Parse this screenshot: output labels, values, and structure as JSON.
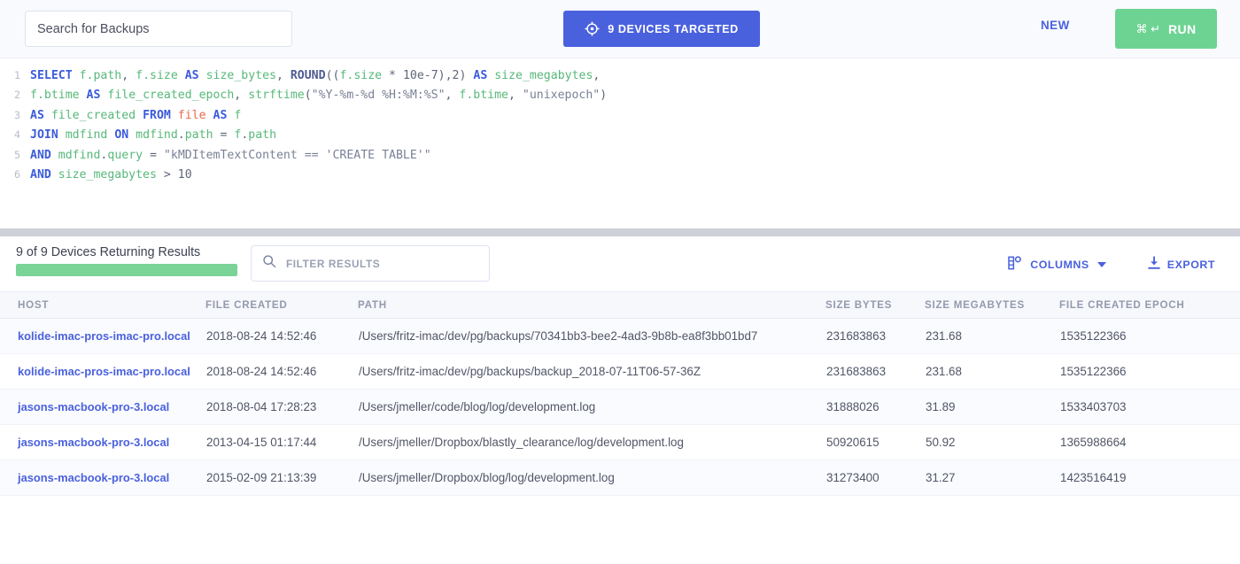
{
  "topbar": {
    "search_placeholder": "Search for Backups",
    "search_value": "",
    "targeted_label": "9 DEVICES TARGETED",
    "targeted_icon": "crosshair-target-icon",
    "new_label": "NEW",
    "run_keys": "⌘ ↵",
    "run_label": "RUN",
    "accent_blue": "#4a61de",
    "accent_green": "#6dd392"
  },
  "editor": {
    "lines": [
      {
        "no": "1",
        "tokens": [
          {
            "t": "SELECT",
            "c": "kw"
          },
          {
            "t": " ",
            "c": "pl"
          },
          {
            "t": "f.path",
            "c": "id"
          },
          {
            "t": ", ",
            "c": "pl"
          },
          {
            "t": "f.size",
            "c": "id"
          },
          {
            "t": " ",
            "c": "pl"
          },
          {
            "t": "AS",
            "c": "kw"
          },
          {
            "t": " ",
            "c": "pl"
          },
          {
            "t": "size_bytes",
            "c": "id"
          },
          {
            "t": ", ",
            "c": "pl"
          },
          {
            "t": "ROUND",
            "c": "fn"
          },
          {
            "t": "((",
            "c": "pl"
          },
          {
            "t": "f.size",
            "c": "id"
          },
          {
            "t": " ",
            "c": "pl"
          },
          {
            "t": "*",
            "c": "op"
          },
          {
            "t": " ",
            "c": "pl"
          },
          {
            "t": "10e-7",
            "c": "num"
          },
          {
            "t": "),",
            "c": "pl"
          },
          {
            "t": "2",
            "c": "num"
          },
          {
            "t": ") ",
            "c": "pl"
          },
          {
            "t": "AS",
            "c": "kw"
          },
          {
            "t": " ",
            "c": "pl"
          },
          {
            "t": "size_megabytes",
            "c": "id"
          },
          {
            "t": ",",
            "c": "pl"
          }
        ]
      },
      {
        "no": "2",
        "tokens": [
          {
            "t": "f.btime",
            "c": "id"
          },
          {
            "t": " ",
            "c": "pl"
          },
          {
            "t": "AS",
            "c": "kw"
          },
          {
            "t": " ",
            "c": "pl"
          },
          {
            "t": "file_created_epoch",
            "c": "id"
          },
          {
            "t": ", ",
            "c": "pl"
          },
          {
            "t": "strftime",
            "c": "id"
          },
          {
            "t": "(",
            "c": "pl"
          },
          {
            "t": "\"%Y-%m-%d %H:%M:%S\"",
            "c": "str"
          },
          {
            "t": ", ",
            "c": "pl"
          },
          {
            "t": "f.btime",
            "c": "id"
          },
          {
            "t": ", ",
            "c": "pl"
          },
          {
            "t": "\"unixepoch\"",
            "c": "str"
          },
          {
            "t": ")",
            "c": "pl"
          }
        ]
      },
      {
        "no": "3",
        "tokens": [
          {
            "t": "AS",
            "c": "kw"
          },
          {
            "t": " ",
            "c": "pl"
          },
          {
            "t": "file_created",
            "c": "id"
          },
          {
            "t": " ",
            "c": "pl"
          },
          {
            "t": "FROM",
            "c": "kw"
          },
          {
            "t": " ",
            "c": "pl"
          },
          {
            "t": "file",
            "c": "tbl"
          },
          {
            "t": " ",
            "c": "pl"
          },
          {
            "t": "AS",
            "c": "kw"
          },
          {
            "t": " ",
            "c": "pl"
          },
          {
            "t": "f",
            "c": "id"
          }
        ]
      },
      {
        "no": "4",
        "tokens": [
          {
            "t": "JOIN",
            "c": "kw"
          },
          {
            "t": " ",
            "c": "pl"
          },
          {
            "t": "mdfind",
            "c": "id"
          },
          {
            "t": " ",
            "c": "pl"
          },
          {
            "t": "ON",
            "c": "kw"
          },
          {
            "t": " ",
            "c": "pl"
          },
          {
            "t": "mdfind",
            "c": "id"
          },
          {
            "t": ".",
            "c": "pl"
          },
          {
            "t": "path",
            "c": "id"
          },
          {
            "t": " ",
            "c": "pl"
          },
          {
            "t": "=",
            "c": "op"
          },
          {
            "t": " ",
            "c": "pl"
          },
          {
            "t": "f",
            "c": "id"
          },
          {
            "t": ".",
            "c": "pl"
          },
          {
            "t": "path",
            "c": "id"
          }
        ]
      },
      {
        "no": "5",
        "tokens": [
          {
            "t": "AND",
            "c": "kw"
          },
          {
            "t": " ",
            "c": "pl"
          },
          {
            "t": "mdfind",
            "c": "id"
          },
          {
            "t": ".",
            "c": "pl"
          },
          {
            "t": "query",
            "c": "id"
          },
          {
            "t": " ",
            "c": "pl"
          },
          {
            "t": "=",
            "c": "op"
          },
          {
            "t": " ",
            "c": "pl"
          },
          {
            "t": "\"kMDItemTextContent == 'CREATE TABLE'\"",
            "c": "str"
          }
        ]
      },
      {
        "no": "6",
        "tokens": [
          {
            "t": "AND",
            "c": "kw"
          },
          {
            "t": " ",
            "c": "pl"
          },
          {
            "t": "size_megabytes",
            "c": "id"
          },
          {
            "t": " ",
            "c": "pl"
          },
          {
            "t": ">",
            "c": "op"
          },
          {
            "t": " ",
            "c": "pl"
          },
          {
            "t": "10",
            "c": "num"
          }
        ]
      }
    ]
  },
  "results": {
    "device_status": "9 of 9 Devices Returning Results",
    "progress_percent": 100,
    "progress_color": "#7ad397",
    "filter_placeholder": "FILTER RESULTS",
    "filter_value": "",
    "search_icon": "search-icon",
    "columns_label": "COLUMNS",
    "columns_icon": "columns-settings-icon",
    "export_label": "EXPORT",
    "export_icon": "download-icon"
  },
  "table": {
    "columns": [
      "HOST",
      "FILE CREATED",
      "PATH",
      "SIZE BYTES",
      "SIZE MEGABYTES",
      "FILE CREATED EPOCH"
    ],
    "rows": [
      {
        "host": "kolide-imac-pros-imac-pro.local",
        "file_created": "2018-08-24 14:52:46",
        "path": "/Users/fritz-imac/dev/pg/backups/70341bb3-bee2-4ad3-9b8b-ea8f3bb01bd7",
        "size_bytes": "231683863",
        "size_megabytes": "231.68",
        "file_created_epoch": "1535122366"
      },
      {
        "host": "kolide-imac-pros-imac-pro.local",
        "file_created": "2018-08-24 14:52:46",
        "path": "/Users/fritz-imac/dev/pg/backups/backup_2018-07-11T06-57-36Z",
        "size_bytes": "231683863",
        "size_megabytes": "231.68",
        "file_created_epoch": "1535122366"
      },
      {
        "host": "jasons-macbook-pro-3.local",
        "file_created": "2018-08-04 17:28:23",
        "path": "/Users/jmeller/code/blog/log/development.log",
        "size_bytes": "31888026",
        "size_megabytes": "31.89",
        "file_created_epoch": "1533403703"
      },
      {
        "host": "jasons-macbook-pro-3.local",
        "file_created": "2013-04-15 01:17:44",
        "path": "/Users/jmeller/Dropbox/blastly_clearance/log/development.log",
        "size_bytes": "50920615",
        "size_megabytes": "50.92",
        "file_created_epoch": "1365988664"
      },
      {
        "host": "jasons-macbook-pro-3.local",
        "file_created": "2015-02-09 21:13:39",
        "path": "/Users/jmeller/Dropbox/blog/log/development.log",
        "size_bytes": "31273400",
        "size_megabytes": "31.27",
        "file_created_epoch": "1423516419"
      }
    ]
  }
}
